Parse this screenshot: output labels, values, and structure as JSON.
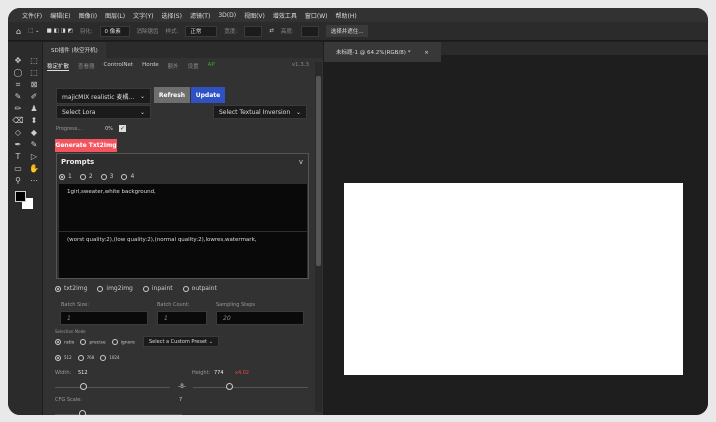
{
  "menu": [
    "文件(F)",
    "编辑(E)",
    "图像(I)",
    "图层(L)",
    "文字(Y)",
    "选择(S)",
    "滤镜(T)",
    "3D(D)",
    "视图(V)",
    "增效工具",
    "窗口(W)",
    "帮助(H)"
  ],
  "options": {
    "feather_label": "羽化:",
    "feather_value": "0 像素",
    "antialias": "消除锯齿",
    "style_label": "样式:",
    "style_value": "正常",
    "width_label": "宽度:",
    "height_label": "高度:",
    "select_mask": "选择并遮住..."
  },
  "tools": [
    "✥",
    "⬚",
    "◯",
    "⬚",
    "⌗",
    "⊠",
    "✎",
    "✐",
    "✏",
    "♟",
    "⌫",
    "⬍",
    "◇",
    "◆",
    "✒",
    "✎",
    "T",
    "▷",
    "▭",
    "✋",
    "⚲",
    "⋯"
  ],
  "panel": {
    "title": "SD插件 (秋空开机)",
    "tabs": [
      "稳定扩散",
      "查看器",
      "ControlNet",
      "Horde",
      "额外",
      "设置"
    ],
    "ap": "AP",
    "version": "v1.3.3",
    "model": "majicMIX realistic 麦橘...",
    "refresh": "Refresh",
    "update": "Update",
    "lora": "Select Lora",
    "textual": "Select Textual Inversion",
    "progress_label": "Progress...",
    "progress_value": "0%",
    "generate": "Generate Txt2Img",
    "prompts_title": "Prompts",
    "prompt_tabs": [
      "1",
      "2",
      "3",
      "4"
    ],
    "positive": "1girl,sweater,white background,",
    "negative": "(worst quality:2),(low quality:2),(normal quality:2),lowres,watermark,",
    "modes": [
      "txt2img",
      "img2img",
      "inpaint",
      "outpaint"
    ],
    "batch_size_label": "Batch Size:",
    "batch_size": "1",
    "batch_count_label": "Batch Count:",
    "batch_count": "1",
    "steps_label": "Sampling Steps",
    "steps": "20",
    "selection_mode_label": "Selection Mode",
    "sel_modes": [
      "ratio",
      "precise",
      "ignore"
    ],
    "preset": "Select a Custom Preset",
    "sizes": [
      "512",
      "768",
      "1024"
    ],
    "width_label": "Width:",
    "width": "512",
    "height_label": "Height:",
    "height": "774",
    "ratio": "x4.02",
    "cfg_label": "CFG Scale:",
    "cfg": "7"
  },
  "document": {
    "tab": "未标题-1 @ 64.2%(RGB/8) *"
  },
  "colors": {
    "generate": "#f4545e",
    "update": "#2e52c4",
    "refresh": "#6e6e6e"
  }
}
